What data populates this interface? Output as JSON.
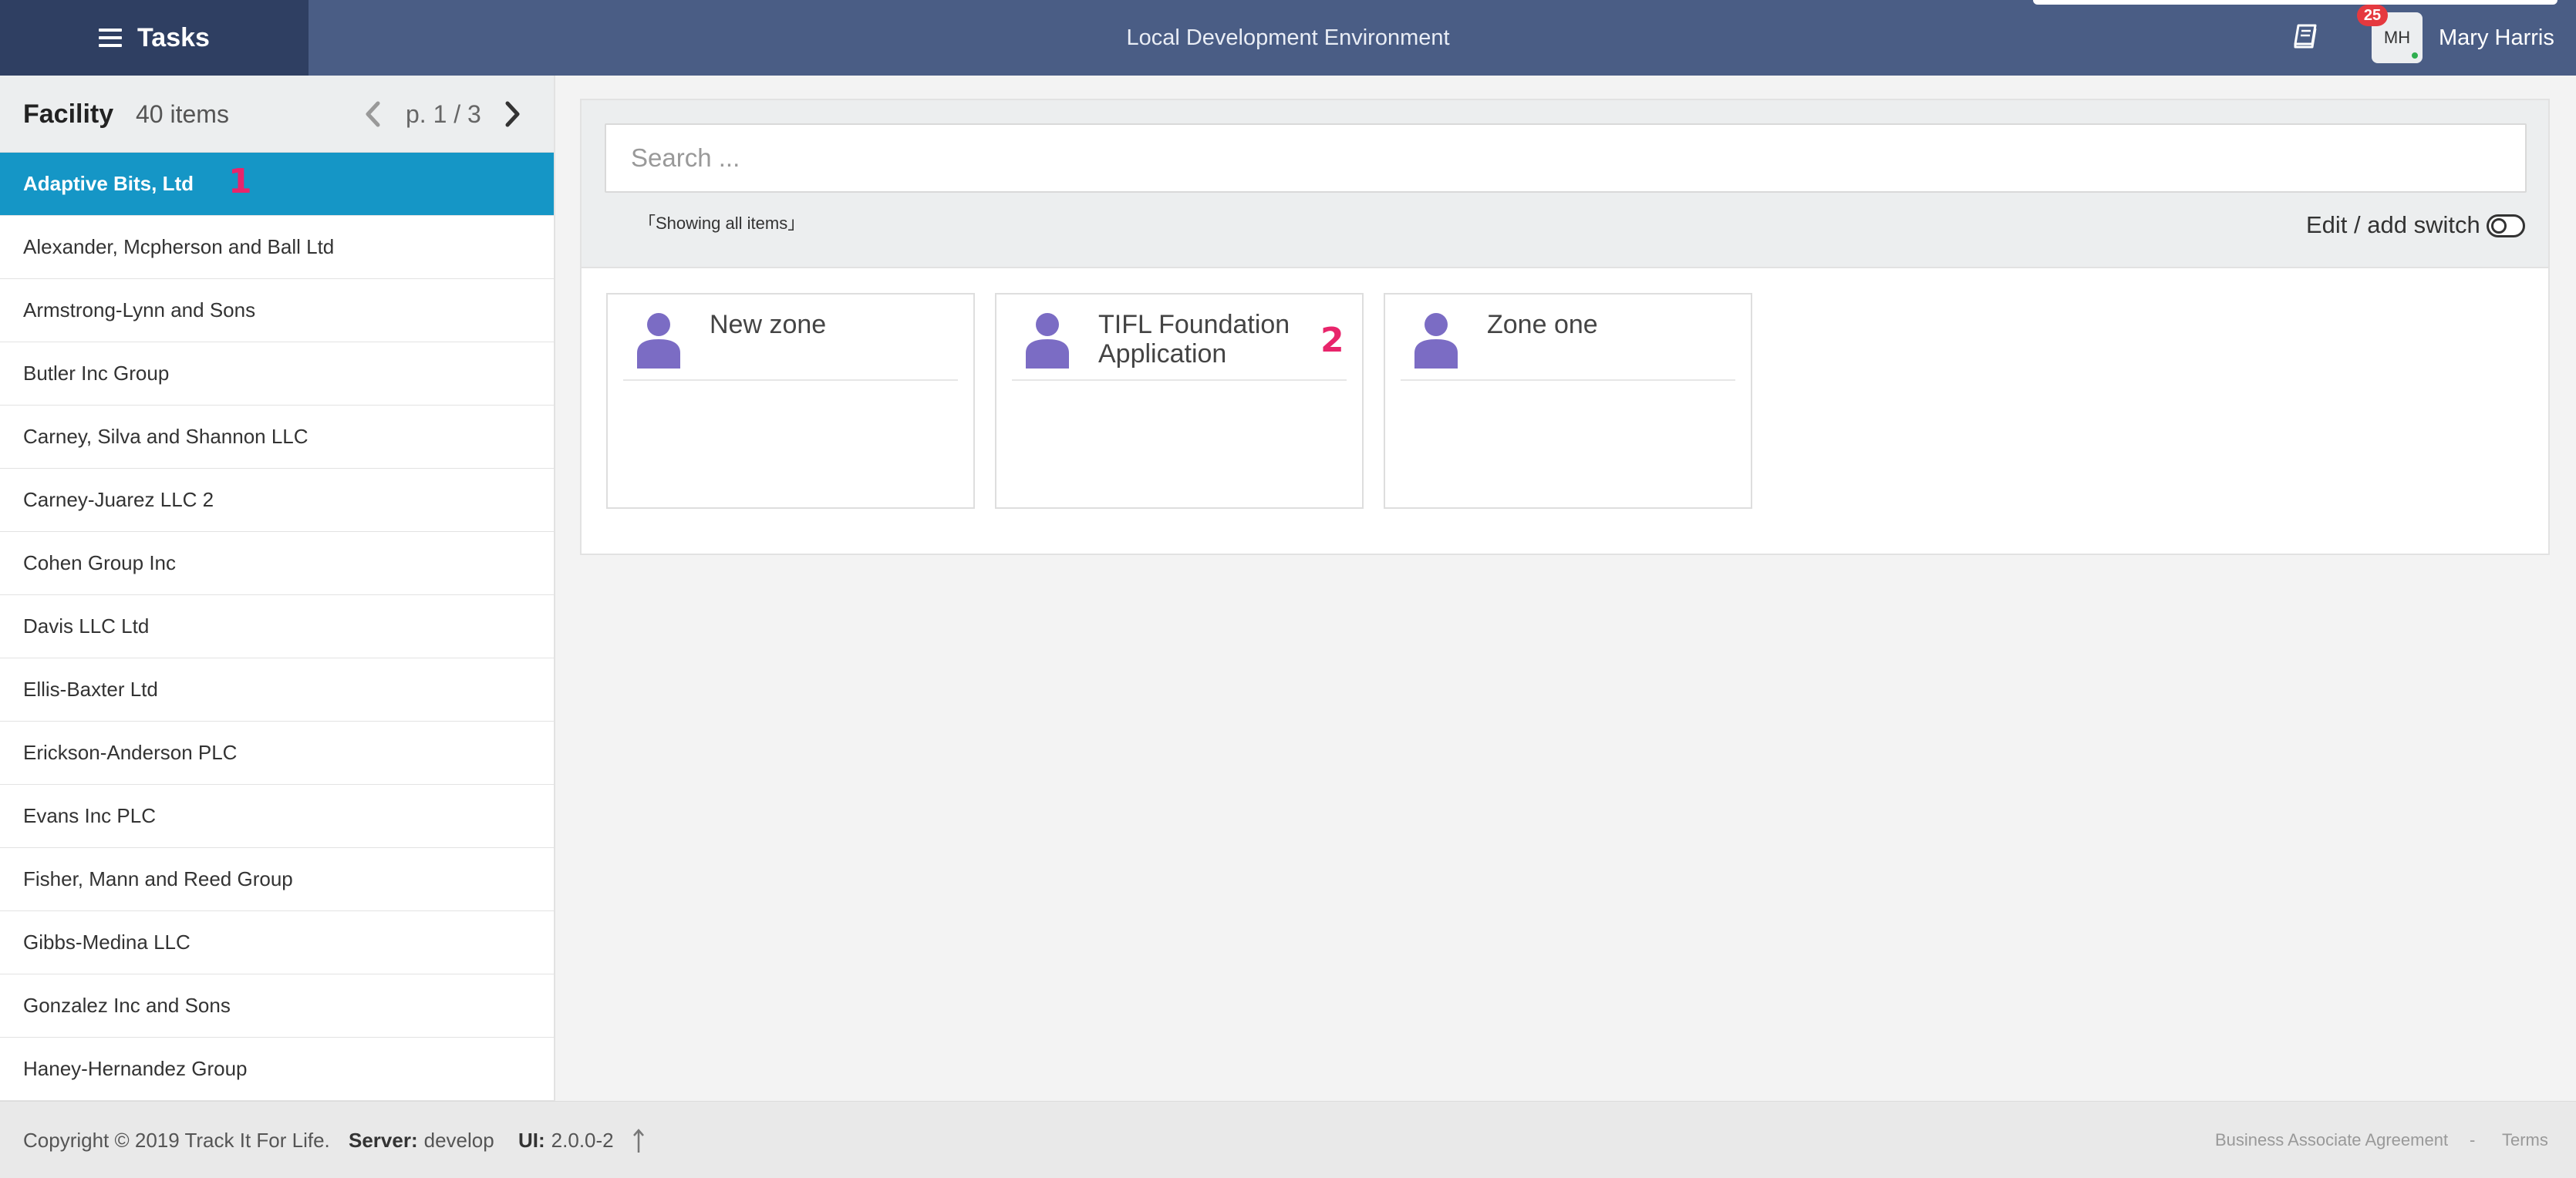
{
  "header": {
    "app_title": "Tasks",
    "environment": "Local Development Environment",
    "notification_count": "25",
    "avatar_initials": "MH",
    "user_name": "Mary Harris",
    "icons": {
      "menu": "hamburger-icon",
      "docs": "book-icon"
    },
    "colors": {
      "bar": "#4a5d85",
      "brand": "#2f3f62",
      "badge": "#e5393f",
      "online": "#2fae4f"
    }
  },
  "sidebar": {
    "title": "Facility",
    "count": "40 items",
    "page": "p. 1 / 3",
    "items": [
      "Adaptive Bits, Ltd",
      "Alexander, Mcpherson and Ball Ltd",
      "Armstrong-Lynn and Sons",
      "Butler Inc Group",
      "Carney, Silva and Shannon LLC",
      "Carney-Juarez LLC 2",
      "Cohen Group Inc",
      "Davis LLC Ltd",
      "Ellis-Baxter Ltd",
      "Erickson-Anderson PLC",
      "Evans Inc PLC",
      "Fisher, Mann and Reed Group",
      "Gibbs-Medina LLC",
      "Gonzalez Inc and Sons",
      "Haney-Hernandez Group"
    ],
    "active_index": 0,
    "active_color": "#1596c6",
    "marker": "1"
  },
  "main": {
    "search_placeholder": "Search ...",
    "showing_label": "「Showing all items」",
    "edit_switch_label": "Edit / add switch",
    "zones": [
      {
        "name": "New zone",
        "marker": ""
      },
      {
        "name": "TIFL Foundation Application",
        "marker": "2"
      },
      {
        "name": "Zone one",
        "marker": ""
      }
    ],
    "zone_icon": "user-icon",
    "zone_icon_color": "#7b6cc4"
  },
  "footer": {
    "copyright": "Copyright © 2019 Track It For Life.",
    "server_label": "Server:",
    "server_value": "develop",
    "ui_label": "UI:",
    "ui_value": "2.0.0-2",
    "baa": "Business Associate Agreement",
    "separator": "-",
    "terms": "Terms"
  },
  "marker_color": "#e8256b"
}
